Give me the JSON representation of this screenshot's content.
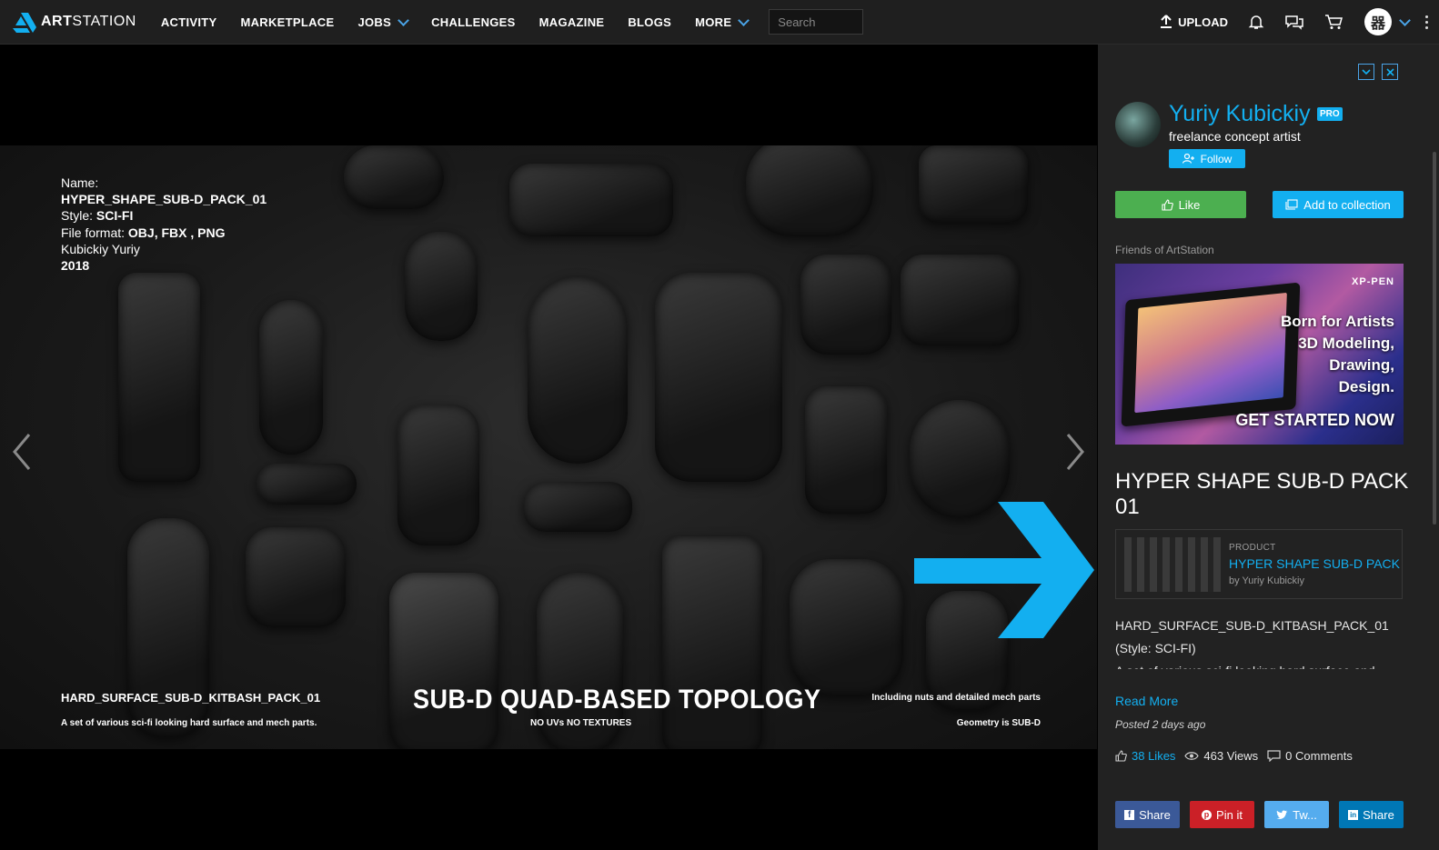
{
  "nav": {
    "brand_bold": "ART",
    "brand_light": "STATION",
    "items": [
      "ACTIVITY",
      "MARKETPLACE",
      "JOBS",
      "CHALLENGES",
      "MAGAZINE",
      "BLOGS",
      "MORE"
    ],
    "search_placeholder": "Search",
    "upload_label": "UPLOAD",
    "avatar_glyph": "器"
  },
  "artwork": {
    "specs": {
      "name_label": "Name:",
      "name_value": "HYPER_SHAPE_SUB-D_PACK_01",
      "style_label": "Style:",
      "style_value": "SCI-FI",
      "format_label": "File format:",
      "format_value": "OBJ, FBX , PNG",
      "author": "Kubickiy Yuriy",
      "year": "2018"
    },
    "bottom_left_title": "HARD_SURFACE_SUB-D_KITBASH_PACK_01",
    "bottom_left_sub": "A set of various sci-fi looking hard surface and mech parts.",
    "center_title": "SUB-D  QUAD-BASED TOPOLOGY",
    "center_sub": "NO  UVs  NO TEXTURES",
    "right_line1": "Including nuts and detailed mech parts",
    "right_line2": "Geometry is SUB-D",
    "arrow_color": "#13aff0"
  },
  "panel": {
    "author_name": "Yuriy Kubickiy",
    "pro_badge": "PRO",
    "author_tagline": "freelance concept artist",
    "follow_label": "Follow",
    "like_label": "Like",
    "collection_label": "Add to collection",
    "friends_label": "Friends of ArtStation",
    "ad": {
      "brand": "XP-PEN",
      "line1": "Born for Artists",
      "line2": "3D Modeling,",
      "line3": "Drawing,",
      "line4": "Design.",
      "cta": "GET STARTED NOW"
    },
    "project_title": "HYPER SHAPE SUB-D PACK 01",
    "product": {
      "kind": "PRODUCT",
      "name": "HYPER SHAPE SUB-D PACK",
      "by": "by Yuriy Kubickiy"
    },
    "description": {
      "line1": "HARD_SURFACE_SUB-D_KITBASH_PACK_01",
      "line2": "(Style: SCI-FI)",
      "line3": "A set of various sci-fi looking hard surface and mech parts"
    },
    "read_more": "Read More",
    "posted": "Posted 2 days ago",
    "stats": {
      "likes": "38 Likes",
      "views": "463 Views",
      "comments": "0 Comments"
    },
    "share": {
      "facebook": "Share",
      "pinterest": "Pin it",
      "twitter": "Tw...",
      "linkedin": "Share"
    }
  },
  "colors": {
    "accent": "#13aff0",
    "like_green": "#4caf50",
    "nav_bg": "#1f1f1f",
    "panel_bg": "#222222"
  }
}
